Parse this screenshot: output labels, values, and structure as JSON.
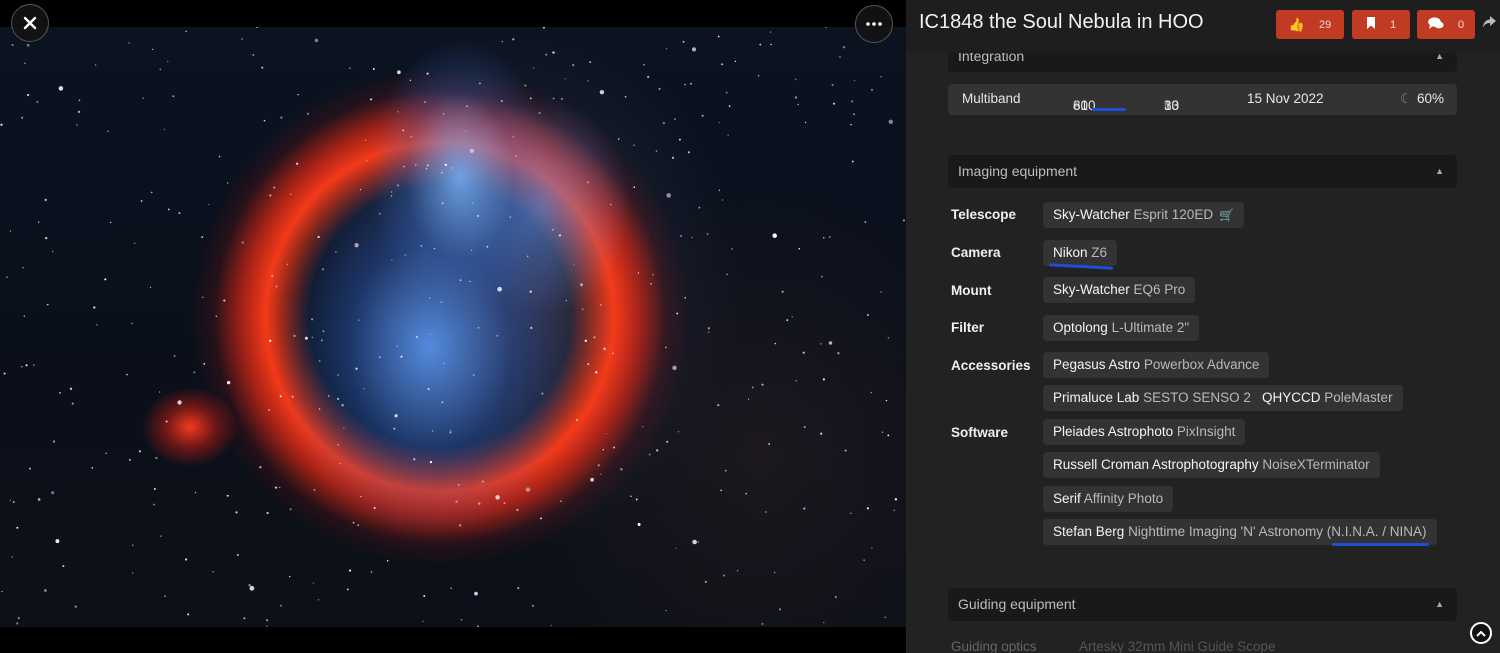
{
  "viewer": {
    "close_icon": "close-icon",
    "more_icon": "more-horizontal-icon",
    "image_subject": "IC1848 the Soul Nebula in HOO"
  },
  "header": {
    "title": "IC1848 the Soul Nebula in HOO",
    "likes": "29",
    "bookmarks": "1",
    "comments": "0",
    "accent_color": "#c13b24"
  },
  "integration": {
    "heading": "Integration",
    "filter": "Multiband",
    "frames": "81",
    "frames_sep": "×",
    "exposure": "600",
    "exposure_unit": "″",
    "hours": "13",
    "hours_unit": "h",
    "minutes": "30",
    "minutes_unit": "′",
    "date": "15 Nov 2022",
    "moon": "60%"
  },
  "imaging": {
    "heading": "Imaging equipment",
    "telescope_label": "Telescope",
    "telescope": {
      "brand": "Sky-Watcher",
      "model": "Esprit 120ED"
    },
    "camera_label": "Camera",
    "camera": {
      "brand": "Nikon",
      "model": "Z6"
    },
    "mount_label": "Mount",
    "mount": {
      "brand": "Sky-Watcher",
      "model": "EQ6 Pro"
    },
    "filter_label": "Filter",
    "filter": {
      "brand": "Optolong",
      "model": "L-Ultimate 2\""
    },
    "accessories_label": "Accessories",
    "accessories": [
      {
        "brand": "Pegasus Astro",
        "model": "Powerbox Advance"
      },
      {
        "brand": "Primaluce Lab",
        "model": "SESTO SENSO 2"
      },
      {
        "brand": "QHYCCD",
        "model": "PoleMaster"
      }
    ],
    "software_label": "Software",
    "software": [
      {
        "brand": "Pleiades Astrophoto",
        "model": "PixInsight"
      },
      {
        "brand": "Russell Croman Astrophotography",
        "model": "NoiseXTerminator"
      },
      {
        "brand": "Serif",
        "model": "Affinity Photo"
      },
      {
        "brand": "Stefan Berg",
        "model": "Nighttime Imaging 'N' Astronomy (N.I.N.A. / NINA)"
      }
    ]
  },
  "guiding": {
    "heading": "Guiding equipment",
    "optics_label": "Guiding optics",
    "optics_value": "Artesky 32mm Mini Guide Scope"
  }
}
